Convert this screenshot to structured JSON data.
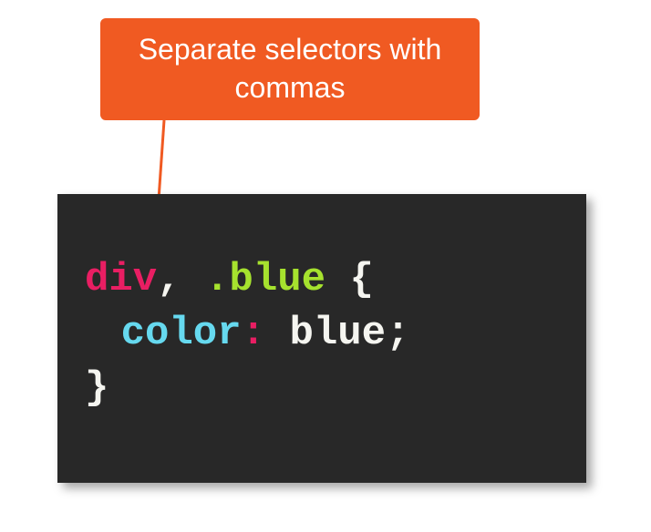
{
  "callout": {
    "text": "Separate selectors with commas"
  },
  "code": {
    "line1": {
      "tag": "div",
      "comma": ",",
      "class": ".blue",
      "brace_open": "{"
    },
    "line2": {
      "property": "color",
      "colon": ":",
      "value": "blue",
      "semicolon": ";"
    },
    "line3": {
      "brace_close": "}"
    }
  }
}
